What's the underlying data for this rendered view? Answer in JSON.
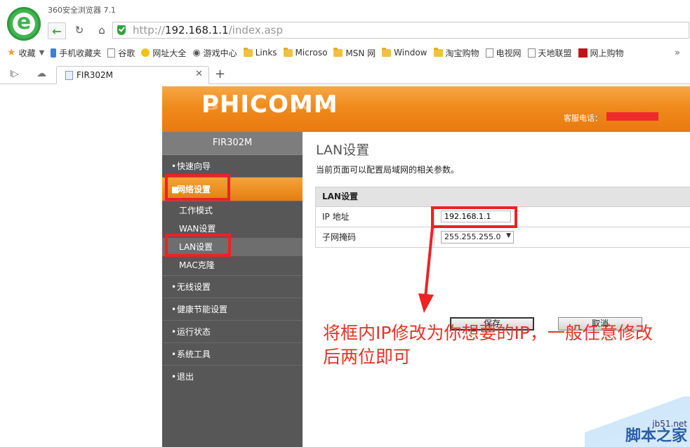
{
  "browser": {
    "title": "360安全浏览器 7.1",
    "url_scheme": "http://",
    "url_host": "192.168.1.1",
    "url_path": "/index.asp",
    "bookmarks": [
      "收藏",
      "手机收藏夹",
      "谷歌",
      "网址大全",
      "游戏中心",
      "Links",
      "Microso",
      "MSN 网",
      "Window",
      "淘宝购物",
      "电视网",
      "天地联盟",
      "网上购物"
    ],
    "tab_label": "FIR302M"
  },
  "router": {
    "brand": "PHICOMM",
    "hotline_label": "客服电话：",
    "model": "FIR302M",
    "nav": {
      "quick_setup": "快速向导",
      "network": "网络设置",
      "work_mode": "工作模式",
      "wan": "WAN设置",
      "lan": "LAN设置",
      "mac": "MAC克隆",
      "wireless": "无线设置",
      "health": "健康节能设置",
      "status": "运行状态",
      "tools": "系统工具",
      "logout": "退出"
    },
    "main": {
      "title": "LAN设置",
      "description": "当前页面可以配置局域网的相关参数。",
      "table_header": "LAN设置",
      "ip_label": "IP 地址",
      "ip_value": "192.168.1.1",
      "mask_label": "子网掩码",
      "mask_value": "255.255.255.0",
      "save": "保存",
      "cancel": "取消"
    }
  },
  "annotation": {
    "instruction": "将框内IP修改为你想要的IP，一般任意修改后两位即可",
    "color": "#ee2222"
  },
  "watermark": {
    "site": "jb51.net",
    "name": "脚本之家"
  }
}
